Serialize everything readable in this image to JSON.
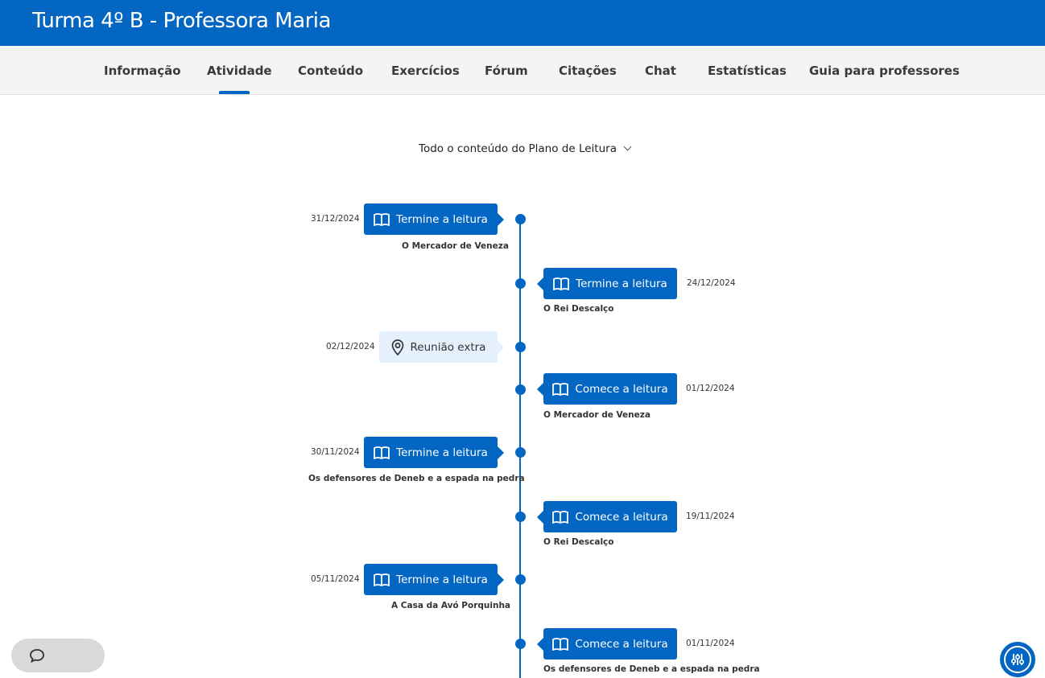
{
  "header": {
    "title": "Turma 4º B - Professora Maria"
  },
  "nav": {
    "tabs": [
      {
        "label": "Informação"
      },
      {
        "label": "Atividade"
      },
      {
        "label": "Conteúdo"
      },
      {
        "label": "Exercícios"
      },
      {
        "label": "Fórum"
      },
      {
        "label": "Citações"
      },
      {
        "label": "Chat"
      },
      {
        "label": "Estatísticas"
      },
      {
        "label": "Guia para professores"
      }
    ],
    "active_tab": "Atividade"
  },
  "filter": {
    "label": "Todo o conteúdo do Plano de Leitura"
  },
  "timeline": [
    {
      "date": "31/12/2024",
      "action": "Termine a leitura",
      "book": "O Mercador de Veneza",
      "icon": "book-icon"
    },
    {
      "date": "24/12/2024",
      "action": "Termine a leitura",
      "book": "O Rei Descalço",
      "icon": "book-icon"
    },
    {
      "date": "02/12/2024",
      "action": "Reunião extra",
      "book": "",
      "icon": "location-pin-icon"
    },
    {
      "date": "01/12/2024",
      "action": "Comece a leitura",
      "book": "O Mercador de Veneza",
      "icon": "book-icon"
    },
    {
      "date": "30/11/2024",
      "action": "Termine a leitura",
      "book": "Os defensores de Deneb e a espada na pedra",
      "icon": "book-icon"
    },
    {
      "date": "19/11/2024",
      "action": "Comece a leitura",
      "book": "O Rei Descalço",
      "icon": "book-icon"
    },
    {
      "date": "05/11/2024",
      "action": "Termine a leitura",
      "book": "A Casa da Avó Porquinha",
      "icon": "book-icon"
    },
    {
      "date": "01/11/2024",
      "action": "Comece a leitura",
      "book": "Os defensores de Deneb e a espada na pedra",
      "icon": "book-icon"
    }
  ],
  "colors": {
    "brand": "#0366c2",
    "nav_bg": "#f4f4f4",
    "meeting_bg": "#e4f0fb"
  },
  "widgets": {
    "chat_icon": "chat-bubble-icon",
    "accessibility_icon": "sliders-icon"
  }
}
